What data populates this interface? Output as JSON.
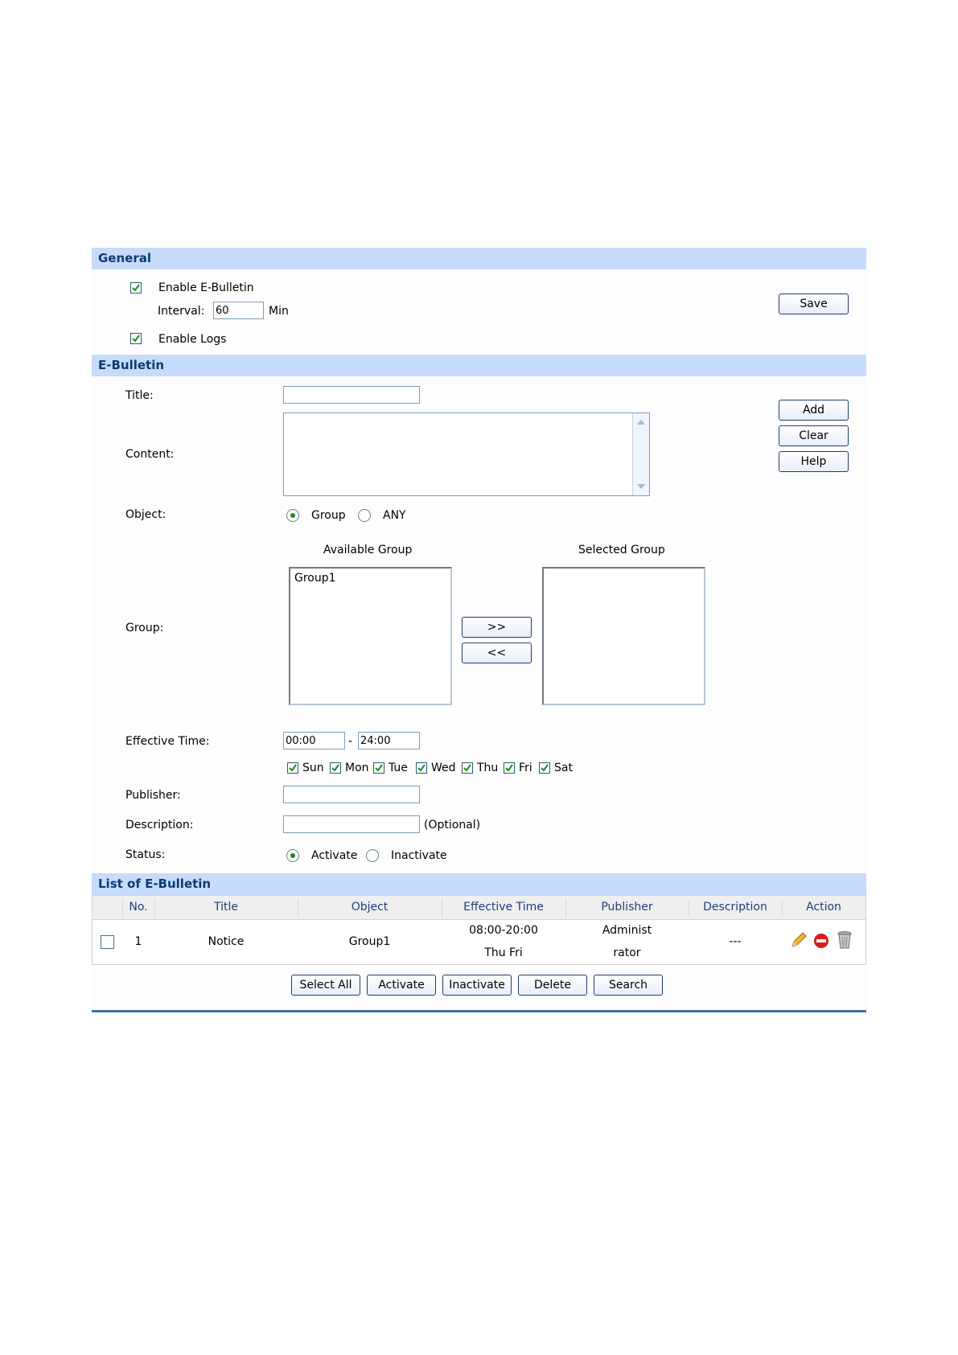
{
  "general": {
    "header": "General",
    "enable_ebulletin_label": "Enable E-Bulletin",
    "interval_label": "Interval:",
    "interval_value": "60",
    "interval_unit": "Min",
    "enable_logs_label": "Enable Logs",
    "save_label": "Save"
  },
  "ebulletin": {
    "header": "E-Bulletin",
    "title_label": "Title:",
    "title_value": "",
    "content_label": "Content:",
    "content_value": "",
    "add_label": "Add",
    "clear_label": "Clear",
    "help_label": "Help",
    "object_label": "Object:",
    "object_options": [
      "Group",
      "ANY"
    ],
    "object_selected": "Group",
    "group_label": "Group:",
    "available_group_label": "Available Group",
    "selected_group_label": "Selected Group",
    "available_groups": [
      "Group1"
    ],
    "selected_groups": [],
    "move_right_label": ">>",
    "move_left_label": "<<",
    "effective_time_label": "Effective Time:",
    "time_start": "00:00",
    "time_separator": "-",
    "time_end": "24:00",
    "days": [
      "Sun",
      "Mon",
      "Tue",
      "Wed",
      "Thu",
      "Fri",
      "Sat"
    ],
    "publisher_label": "Publisher:",
    "publisher_value": "",
    "description_label": "Description:",
    "description_value": "",
    "description_hint": "(Optional)",
    "status_label": "Status:",
    "status_options": [
      "Activate",
      "Inactivate"
    ],
    "status_selected": "Activate"
  },
  "list": {
    "header": "List of E-Bulletin",
    "columns": [
      "No.",
      "Title",
      "Object",
      "Effective Time",
      "Publisher",
      "Description",
      "Action"
    ],
    "rows": [
      {
        "no": "1",
        "title": "Notice",
        "object": "Group1",
        "time_line1": "08:00-20:00",
        "time_line2": "Thu Fri",
        "publisher_line1": "Administ",
        "publisher_line2": "rator",
        "description": "---"
      }
    ],
    "buttons": {
      "select_all": "Select All",
      "activate": "Activate",
      "inactivate": "Inactivate",
      "delete": "Delete",
      "search": "Search"
    }
  },
  "colors": {
    "section_header_bg": "#c7dbfb",
    "section_header_text": "#0b3b73",
    "check_green": "#1c8a1c"
  }
}
